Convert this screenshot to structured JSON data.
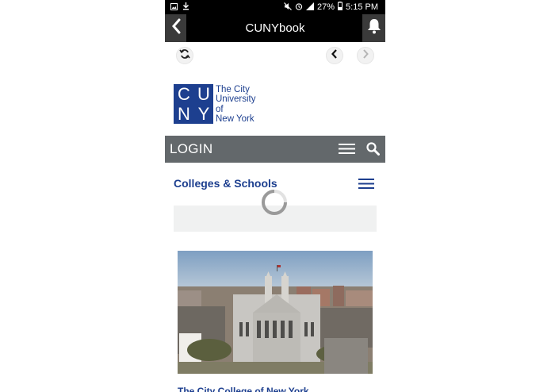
{
  "status_bar": {
    "battery_percent": "27%",
    "time": "5:15 PM",
    "icons": [
      "image-icon",
      "download-icon",
      "mute-icon",
      "alarm-icon",
      "signal-icon",
      "battery-icon"
    ]
  },
  "app_bar": {
    "title": "CUNYbook",
    "back_icon": "chevron-left-icon",
    "notification_icon": "bell-icon"
  },
  "nav_row": {
    "refresh_icon": "refresh-icon",
    "prev_icon": "chevron-left-icon",
    "next_icon": "chevron-right-icon"
  },
  "logo": {
    "block_letters": [
      "C",
      "U",
      "N",
      "Y"
    ],
    "text_lines": [
      "The City",
      "University",
      "of",
      "New York"
    ]
  },
  "login_bar": {
    "label": "LOGIN",
    "menu_icon": "hamburger-menu-icon",
    "search_icon": "search-icon"
  },
  "section": {
    "title": "Colleges & Schools",
    "menu_icon": "hamburger-menu-icon",
    "loading_icon": "spinner-icon"
  },
  "feature": {
    "image_description_icon": "campus-photo",
    "caption": "The City College of New York"
  },
  "colors": {
    "brand_blue": "#1d3f8f",
    "login_bar_gray": "#63686b",
    "app_bar_black": "#000000"
  }
}
